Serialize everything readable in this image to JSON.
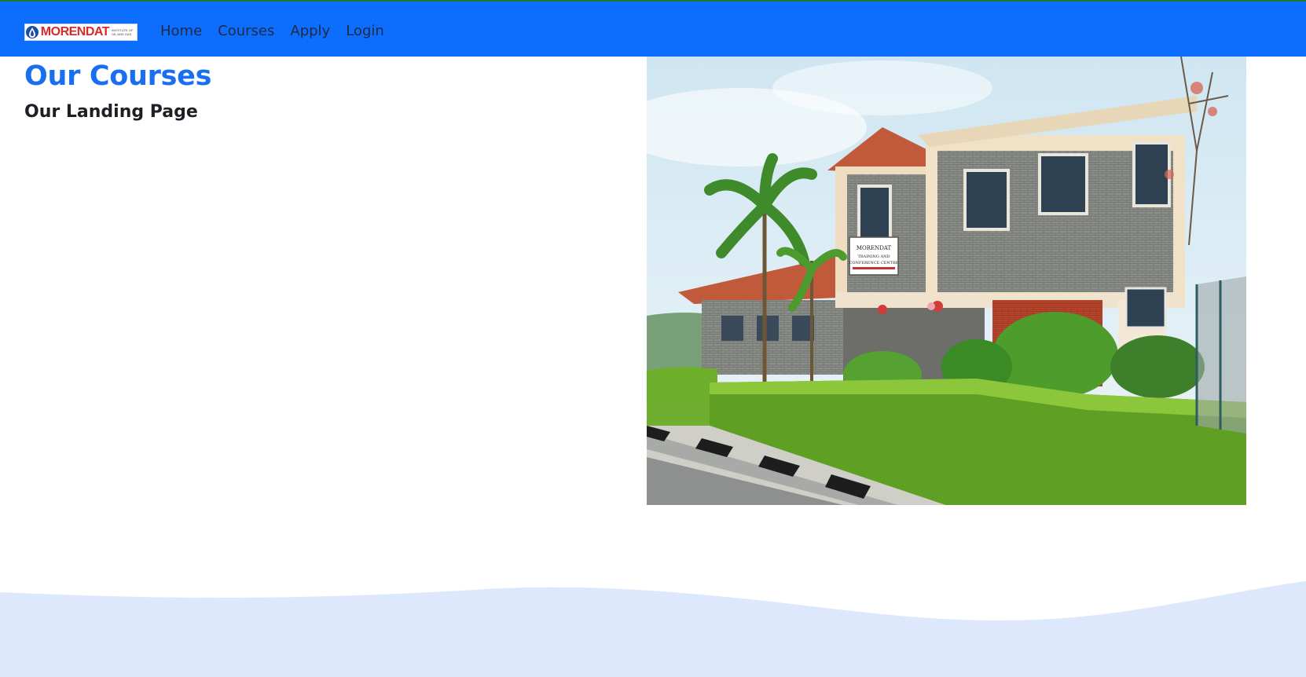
{
  "brand": {
    "name": "MORENDAT",
    "tagline": "Institute of Oil and Gas",
    "logo_icon": "oil-drop-icon",
    "accent_color": "#d62a2a"
  },
  "nav": {
    "items": [
      {
        "label": "Home"
      },
      {
        "label": "Courses"
      },
      {
        "label": "Apply"
      },
      {
        "label": "Login"
      }
    ],
    "bar_color": "#0d6efd"
  },
  "main": {
    "title": "Our Courses",
    "subtitle": "Our Landing Page"
  },
  "hero": {
    "building_sign": [
      "MORENDAT",
      "TRAINING AND",
      "CONFERENCE CENTRE"
    ]
  },
  "footer_wave": {
    "color": "#dde8fd"
  }
}
